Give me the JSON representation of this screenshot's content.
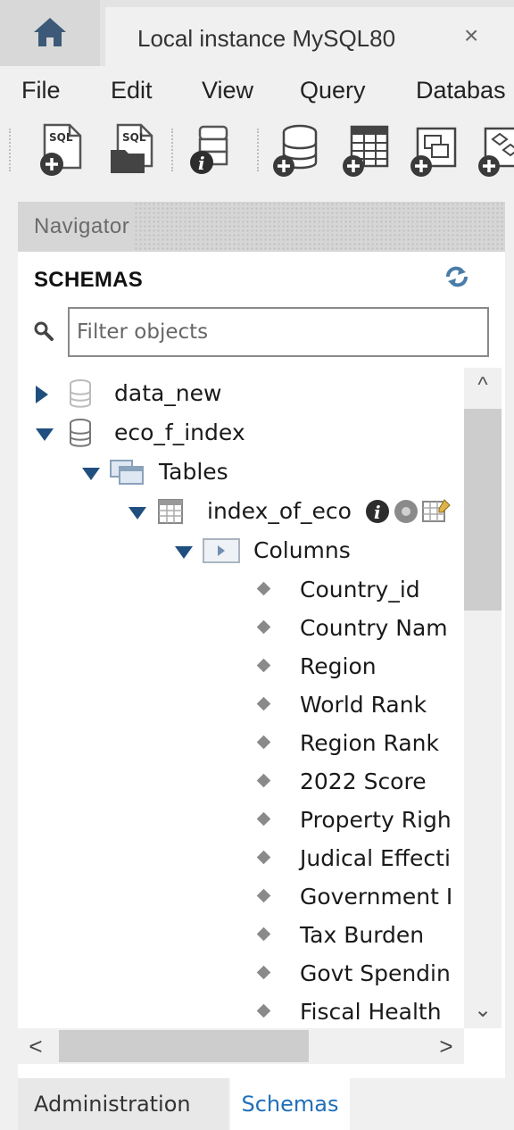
{
  "tabs": {
    "home_icon": "home-icon",
    "connection_title": "Local instance MySQL80",
    "close": "×"
  },
  "menu": [
    "File",
    "Edit",
    "View",
    "Query",
    "Databas"
  ],
  "toolbar": {
    "icons": [
      "new-sql-tab-icon",
      "open-sql-script-icon",
      "schema-inspector-icon",
      "create-schema-icon",
      "create-table-icon",
      "create-view-icon",
      "create-procedure-icon"
    ],
    "badge_text": "SQL"
  },
  "navigator": {
    "header": "Navigator",
    "schemas_title": "SCHEMAS",
    "filter_placeholder": "Filter objects"
  },
  "tree": {
    "schema1": "data_new",
    "schema2": "eco_f_index",
    "tables": "Tables",
    "table": "index_of_eco",
    "columns_label": "Columns",
    "columns": [
      "Country_id",
      "Country Nam",
      "Region",
      "World Rank",
      "Region Rank",
      "2022 Score",
      "Property Righ",
      "Judical Effecti",
      "Government I",
      "Tax Burden",
      "Govt Spendin",
      "Fiscal Health"
    ]
  },
  "scroll": {
    "up": "^",
    "down": "⌄",
    "left": "<",
    "right": ">"
  },
  "bottom_tabs": {
    "administration": "Administration",
    "schemas": "Schemas"
  },
  "colors": {
    "accent": "#1f6fb8",
    "arrow": "#1f4f7f",
    "background": "#f0f0f0"
  }
}
